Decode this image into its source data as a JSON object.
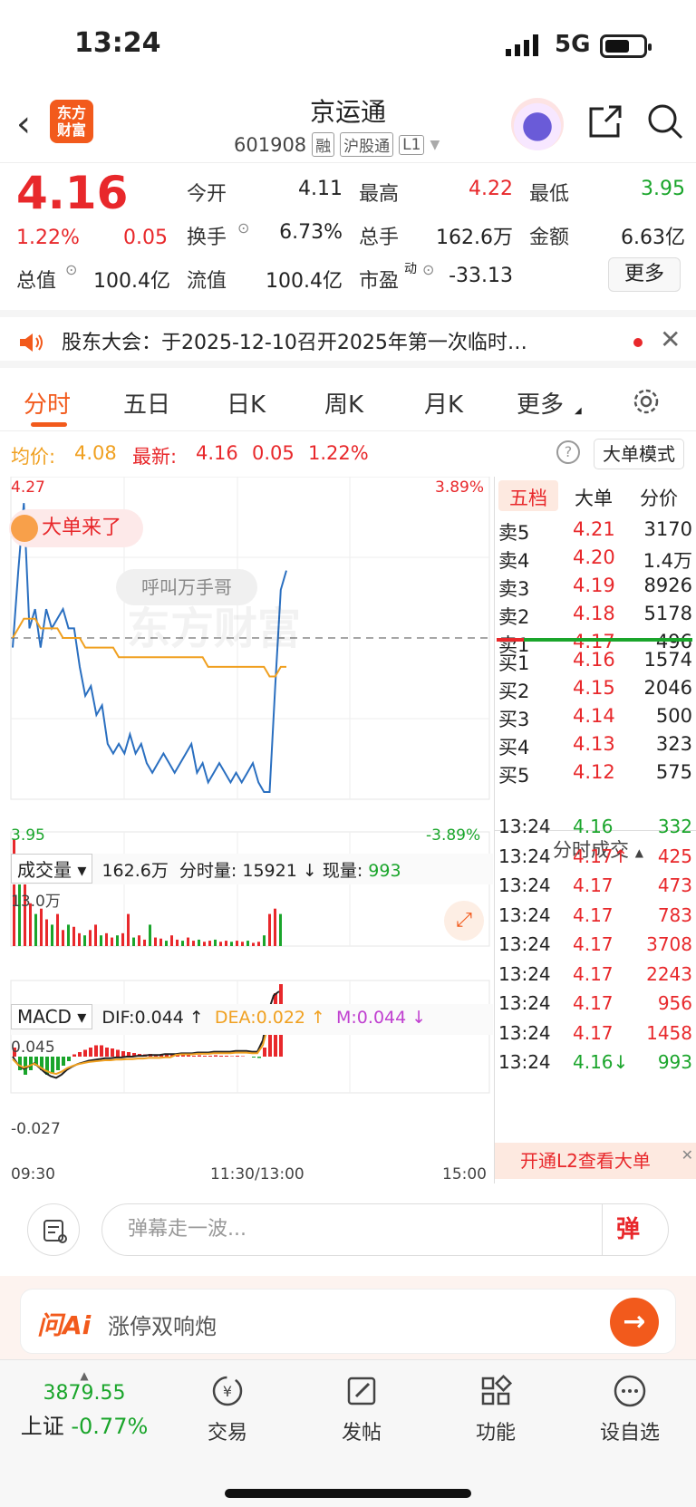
{
  "status": {
    "time": "13:24",
    "network": "5G"
  },
  "header": {
    "logo_line1": "东方",
    "logo_line2": "财富",
    "stock_name": "京运通",
    "code": "601908",
    "tags": [
      "融",
      "沪股通",
      "L1"
    ]
  },
  "quote": {
    "price": "4.16",
    "pct": "1.22%",
    "change": "0.05",
    "open_label": "今开",
    "open": "4.11",
    "high_label": "最高",
    "high": "4.22",
    "low_label": "最低",
    "low": "3.95",
    "turnover_label": "换手",
    "turnover": "6.73%",
    "volume_label": "总手",
    "volume": "162.6万",
    "amount_label": "金额",
    "amount": "6.63亿",
    "total_mv_label": "总值",
    "total_mv": "100.4亿",
    "float_mv_label": "流值",
    "float_mv": "100.4亿",
    "pe_label": "市盈",
    "pe_sup": "动",
    "pe": "-33.13",
    "more_label": "更多"
  },
  "notice": {
    "text": "股东大会：于2025-12-10召开2025年第一次临时…"
  },
  "tabs": [
    "分时",
    "五日",
    "日K",
    "周K",
    "月K",
    "更多"
  ],
  "infoline": {
    "avg_label": "均价:",
    "avg": "4.08",
    "latest_label": "最新:",
    "latest": "4.16",
    "change": "0.05",
    "pct": "1.22%",
    "mode_label": "大单模式"
  },
  "chart": {
    "price_top": "4.27",
    "price_bottom": "3.95",
    "pct_top": "3.89%",
    "pct_bottom": "-3.89%",
    "big_order": "大单来了",
    "call_btn": "呼叫万手哥",
    "watermark": "东方财富",
    "vol_select": "成交量",
    "vol_total": "162.6万",
    "vol_period_label": "分时量:",
    "vol_period": "15921",
    "vol_now_label": "现量:",
    "vol_now": "993",
    "vol_max": "13.0万",
    "macd_select": "MACD",
    "dif": "DIF:0.044 ↑",
    "dea": "DEA:0.022 ↑",
    "m": "M:0.044 ↓",
    "macd_top": "0.045",
    "macd_bottom": "-0.027",
    "time_start": "09:30",
    "time_mid": "11:30/13:00",
    "time_end": "15:00"
  },
  "chart_data": {
    "type": "line",
    "title": "",
    "xlabel": "",
    "ylabel": "",
    "ylim": [
      3.95,
      4.27
    ],
    "x_ticks": [
      "09:30",
      "11:30/13:00",
      "15:00"
    ],
    "series": [
      {
        "name": "",
        "values": [
          4.1,
          4.18,
          4.25,
          4.12,
          4.14,
          4.1,
          4.14,
          4.12,
          4.13,
          4.14,
          4.12,
          4.12,
          4.08,
          4.05,
          4.06,
          4.03,
          4.04,
          4.0,
          3.99,
          4.0,
          3.99,
          4.01,
          3.99,
          4.0,
          3.98,
          3.97,
          3.98,
          3.99,
          3.98,
          3.97,
          3.98,
          3.99,
          4.0,
          3.97,
          3.98,
          3.96,
          3.97,
          3.98,
          3.97,
          3.96,
          3.97,
          3.96,
          3.97,
          3.98,
          3.96,
          3.95,
          3.95,
          4.06,
          4.16,
          4.18
        ]
      },
      {
        "name": "",
        "values": [
          4.11,
          4.12,
          4.13,
          4.13,
          4.13,
          4.12,
          4.12,
          4.12,
          4.12,
          4.11,
          4.11,
          4.11,
          4.11,
          4.1,
          4.1,
          4.1,
          4.1,
          4.1,
          4.1,
          4.09,
          4.09,
          4.09,
          4.09,
          4.09,
          4.09,
          4.09,
          4.09,
          4.09,
          4.09,
          4.09,
          4.09,
          4.09,
          4.09,
          4.09,
          4.09,
          4.08,
          4.08,
          4.08,
          4.08,
          4.08,
          4.08,
          4.08,
          4.08,
          4.08,
          4.08,
          4.08,
          4.07,
          4.07,
          4.08,
          4.08
        ]
      }
    ],
    "prev_close": 4.11
  },
  "book": {
    "tabs": [
      "五档",
      "大单",
      "分价"
    ],
    "asks": [
      {
        "label": "卖5",
        "price": "4.21",
        "vol": "3170"
      },
      {
        "label": "卖4",
        "price": "4.20",
        "vol": "1.4万"
      },
      {
        "label": "卖3",
        "price": "4.19",
        "vol": "8926"
      },
      {
        "label": "卖2",
        "price": "4.18",
        "vol": "5178"
      },
      {
        "label": "卖1",
        "price": "4.17",
        "vol": "496"
      }
    ],
    "bids": [
      {
        "label": "买1",
        "price": "4.16",
        "vol": "1574"
      },
      {
        "label": "买2",
        "price": "4.15",
        "vol": "2046"
      },
      {
        "label": "买3",
        "price": "4.14",
        "vol": "500"
      },
      {
        "label": "买4",
        "price": "4.13",
        "vol": "323"
      },
      {
        "label": "买5",
        "price": "4.12",
        "vol": "575"
      }
    ],
    "ticks_header": "分时成交",
    "ticks": [
      {
        "time": "13:24",
        "price": "4.16",
        "vol": "332",
        "color": "green"
      },
      {
        "time": "13:24",
        "price": "4.17↑",
        "vol": "425",
        "color": "red"
      },
      {
        "time": "13:24",
        "price": "4.17",
        "vol": "473",
        "color": "red"
      },
      {
        "time": "13:24",
        "price": "4.17",
        "vol": "783",
        "color": "red"
      },
      {
        "time": "13:24",
        "price": "4.17",
        "vol": "3708",
        "color": "red"
      },
      {
        "time": "13:24",
        "price": "4.17",
        "vol": "2243",
        "color": "red"
      },
      {
        "time": "13:24",
        "price": "4.17",
        "vol": "956",
        "color": "red"
      },
      {
        "time": "13:24",
        "price": "4.17",
        "vol": "1458",
        "color": "red"
      },
      {
        "time": "13:24",
        "price": "4.16↓",
        "vol": "993",
        "color": "green"
      }
    ],
    "l2_label": "开通L2查看大单"
  },
  "comment": {
    "placeholder": "弹幕走一波...",
    "dan": "弹"
  },
  "askai": {
    "logo": "问Ai",
    "text": "涨停双响炮"
  },
  "bottomnav": {
    "index_value": "3879.55",
    "index_name": "上证",
    "index_pct": "-0.77%",
    "items": [
      "交易",
      "发帖",
      "功能",
      "设自选"
    ]
  },
  "colors": {
    "up": "#e8282b",
    "down": "#1aa52b",
    "brand": "#f25a1c",
    "price_line": "#2a6fc0",
    "avg_line": "#f0a020"
  }
}
